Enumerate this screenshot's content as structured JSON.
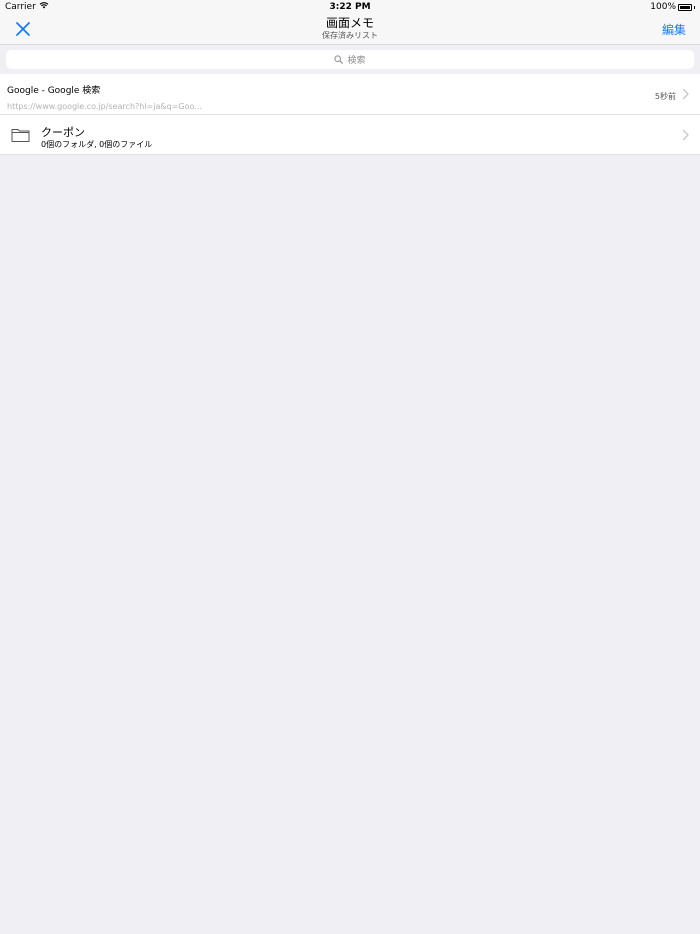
{
  "status_bar": {
    "carrier": "Carrier",
    "time": "3:22 PM",
    "battery": "100%"
  },
  "nav": {
    "title": "画面メモ",
    "subtitle": "保存済みリスト",
    "edit_label": "編集"
  },
  "search": {
    "placeholder": "検索"
  },
  "list": {
    "page_item": {
      "title": "Google - Google 検索",
      "url": "https://www.google.co.jp/search?hl=ja&q=Goo...",
      "time": "5秒前"
    },
    "folder_item": {
      "name": "クーポン",
      "meta": "0個のフォルダ, 0個のファイル"
    }
  },
  "colors": {
    "accent": "#1a7cf5",
    "background": "#efeff4"
  }
}
